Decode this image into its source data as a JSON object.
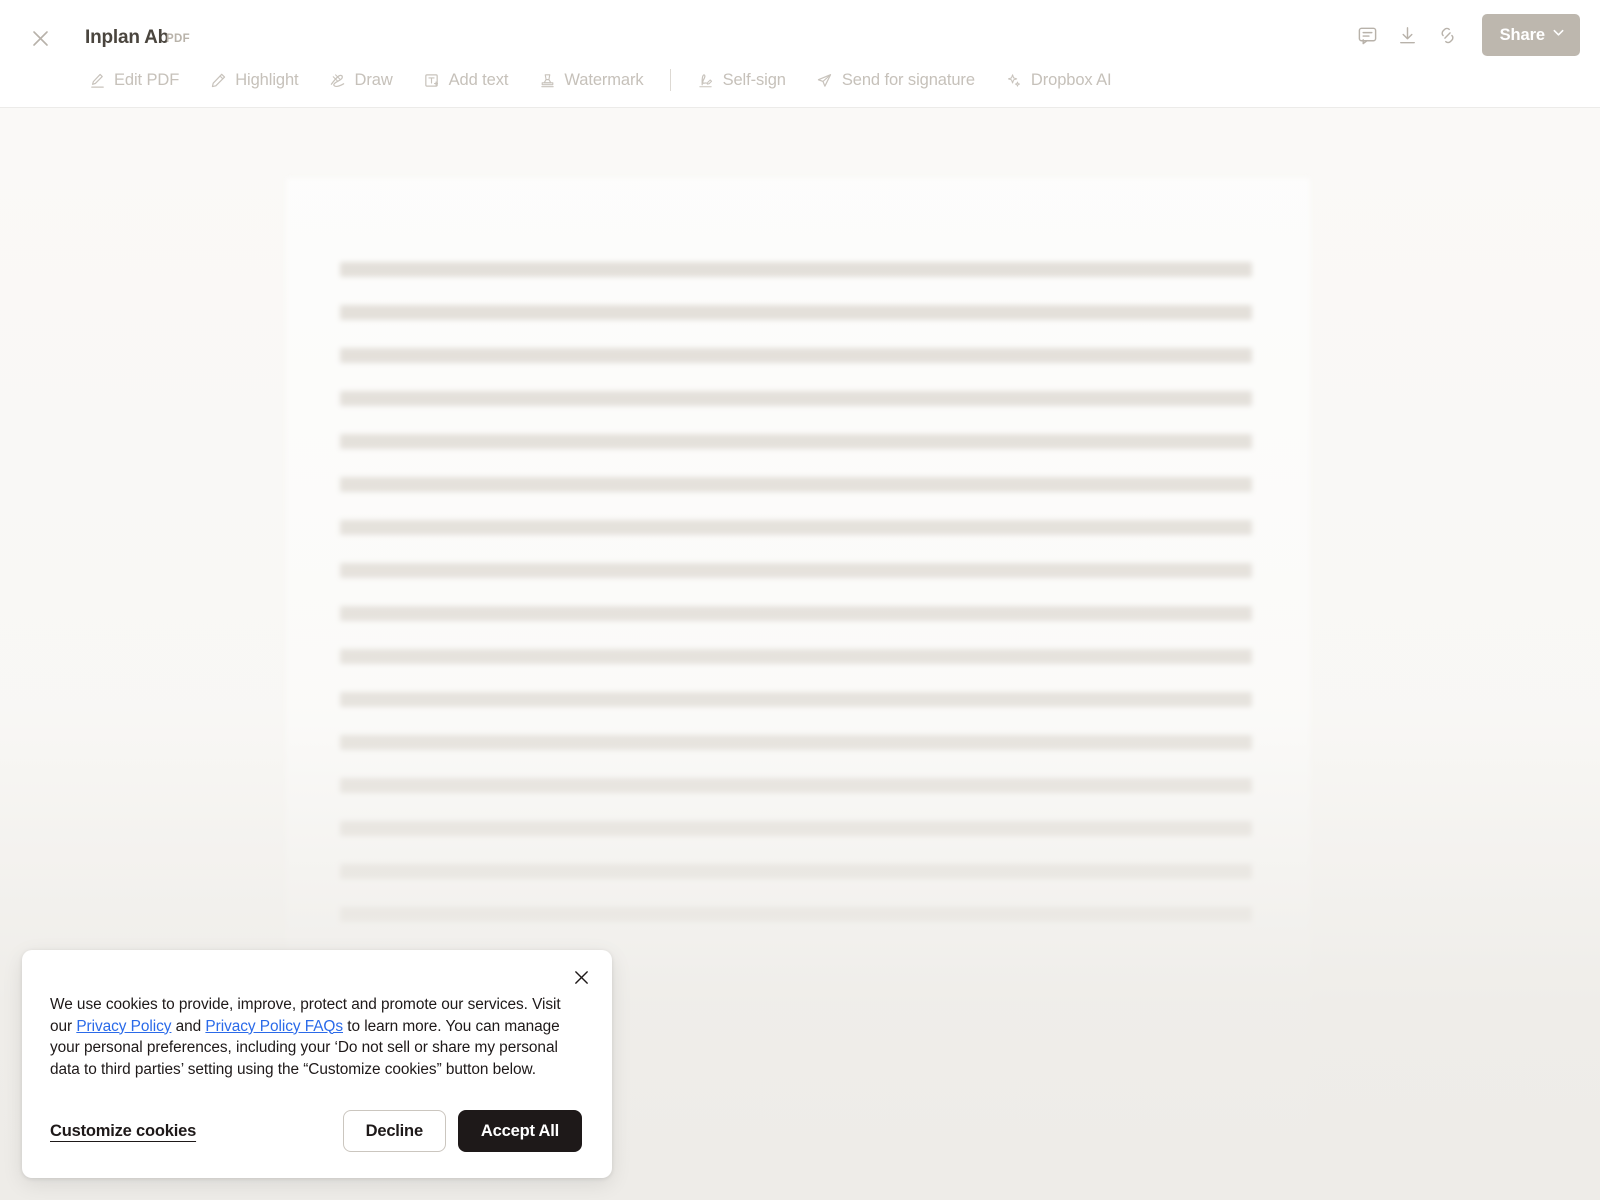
{
  "header": {
    "close_icon": "close-icon",
    "title": "Inplan Ab",
    "file_type": "PDF",
    "actions": [
      {
        "name": "comment-icon",
        "label": "Comment"
      },
      {
        "name": "download-icon",
        "label": "Download"
      },
      {
        "name": "link-icon",
        "label": "Copy link"
      }
    ],
    "share_label": "Share",
    "share_chevron_icon": "chevron-down-icon",
    "share_bg_color": "#bdb7ae"
  },
  "toolbar": {
    "items": [
      {
        "label": "Edit PDF",
        "icon": "pencil-underline-icon"
      },
      {
        "label": "Highlight",
        "icon": "highlighter-pen-icon"
      },
      {
        "label": "Draw",
        "icon": "scribble-icon"
      },
      {
        "label": "Add text",
        "icon": "text-box-plus-icon"
      },
      {
        "label": "Watermark",
        "icon": "watermark-stamp-icon"
      }
    ],
    "items_after_divider": [
      {
        "label": "Self-sign",
        "icon": "signature-pen-icon"
      },
      {
        "label": "Send for signature",
        "icon": "paper-plane-icon"
      },
      {
        "label": "Dropbox AI",
        "icon": "sparkle-icon"
      }
    ]
  },
  "document": {
    "state": "loading",
    "skeleton_line_count": 16,
    "page_background": "#fdfdfc",
    "viewer_background": "#faf9f7"
  },
  "cookie_banner": {
    "close_icon": "close-icon",
    "text_part_1": "We use cookies to provide, improve, protect and promote our services. Visit our ",
    "link_1": "Privacy Policy",
    "text_part_2": " and ",
    "link_2": "Privacy Policy FAQs",
    "text_part_3": " to learn more. You can manage your personal preferences, including your ‘Do not sell or share my personal data to third parties’ setting using the “Customize cookies” button below.",
    "customize_label": "Customize cookies",
    "decline_label": "Decline",
    "accept_label": "Accept All",
    "link_color": "#2a6ae9",
    "accept_bg_color": "#1e1919"
  }
}
